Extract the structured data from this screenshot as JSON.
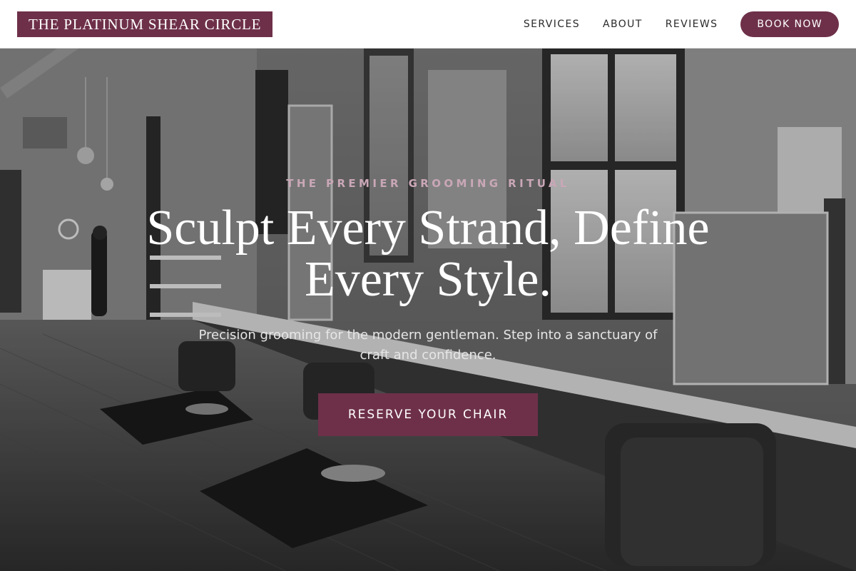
{
  "brand": {
    "name": "THE PLATINUM SHEAR CIRCLE",
    "accent_color": "#6e3049"
  },
  "nav": {
    "links": [
      {
        "label": "SERVICES"
      },
      {
        "label": "ABOUT"
      },
      {
        "label": "REVIEWS"
      }
    ],
    "book_label": "BOOK NOW"
  },
  "hero": {
    "background": "grayscale-salon-interior-photo",
    "eyebrow": "THE PREMIER GROOMING RITUAL",
    "headline": "Sculpt Every Strand, Define Every Style.",
    "subtext": "Precision grooming for the modern gentleman. Step into a sanctuary of craft and confidence.",
    "cta_label": "RESERVE YOUR CHAIR"
  }
}
